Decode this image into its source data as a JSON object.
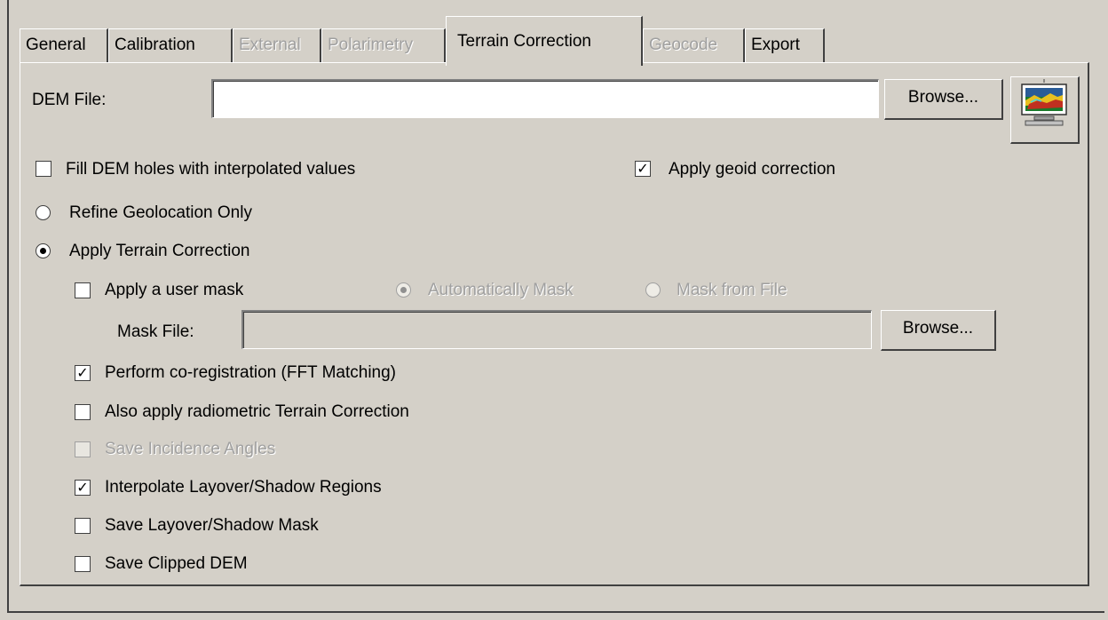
{
  "tabs": [
    {
      "label": "General",
      "state": "normal"
    },
    {
      "label": "Calibration",
      "state": "normal"
    },
    {
      "label": "External",
      "state": "disabled"
    },
    {
      "label": "Polarimetry",
      "state": "disabled"
    },
    {
      "label": "Terrain Correction",
      "state": "active"
    },
    {
      "label": "Geocode",
      "state": "disabled"
    },
    {
      "label": "Export",
      "state": "normal"
    }
  ],
  "dem": {
    "label": "DEM File:",
    "value": "",
    "browse_label": "Browse...",
    "preview_icon": "dem-image-icon"
  },
  "options": {
    "fill_holes": {
      "label": "Fill DEM holes with interpolated values",
      "checked": false
    },
    "geoid": {
      "label": "Apply geoid correction",
      "checked": true
    },
    "refine_geolocation": {
      "label": "Refine Geolocation Only",
      "selected": false
    },
    "apply_terrain": {
      "label": "Apply Terrain Correction",
      "selected": true
    },
    "user_mask": {
      "label": "Apply a user mask",
      "checked": false
    },
    "auto_mask": {
      "label": "Automatically Mask",
      "selected": true,
      "enabled": false
    },
    "mask_from_file": {
      "label": "Mask from File",
      "selected": false,
      "enabled": false
    },
    "mask_file": {
      "label": "Mask File:",
      "value": "",
      "browse_label": "Browse..."
    },
    "coregistration": {
      "label": "Perform co-registration (FFT Matching)",
      "checked": true
    },
    "radiometric": {
      "label": "Also apply radiometric Terrain Correction",
      "checked": false
    },
    "incidence": {
      "label": "Save Incidence Angles",
      "checked": false,
      "enabled": false
    },
    "interpolate_layover": {
      "label": "Interpolate Layover/Shadow Regions",
      "checked": true
    },
    "save_layover": {
      "label": "Save Layover/Shadow Mask",
      "checked": false
    },
    "save_clipped": {
      "label": "Save Clipped DEM",
      "checked": false
    }
  },
  "check_glyph": "✓"
}
